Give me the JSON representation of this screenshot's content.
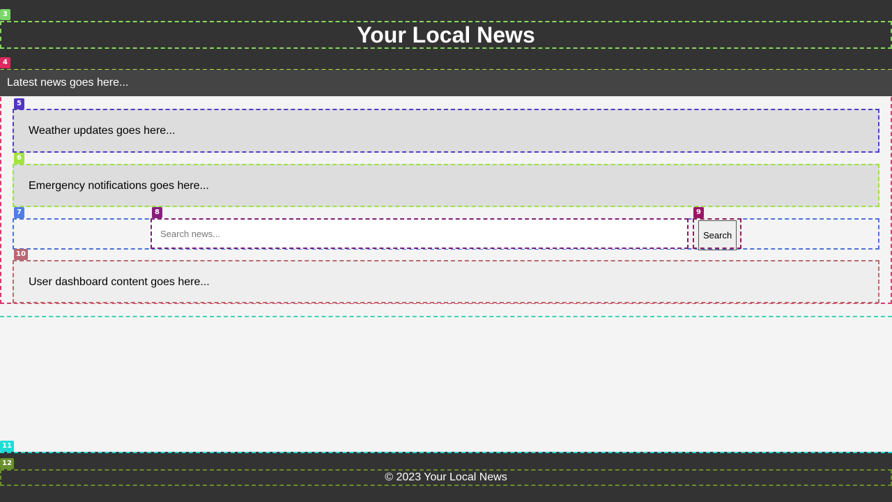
{
  "header": {
    "title": "Your Local News"
  },
  "ticker": {
    "text": "Latest news goes here..."
  },
  "weather": {
    "text": "Weather updates goes here..."
  },
  "emergency": {
    "text": "Emergency notifications goes here..."
  },
  "search": {
    "value": "",
    "placeholder": "Search news...",
    "button_label": "Search"
  },
  "dashboard": {
    "text": "User dashboard content goes here..."
  },
  "footer": {
    "text": "© 2023 Your Local News"
  },
  "tags": [
    {
      "label": "3",
      "color": "#7bd66a"
    },
    {
      "label": "4",
      "color": "#e0285f"
    },
    {
      "label": "5",
      "color": "#5335c4"
    },
    {
      "label": "6",
      "color": "#a3e33d"
    },
    {
      "label": "7",
      "color": "#4f7ee6"
    },
    {
      "label": "8",
      "color": "#871f7d"
    },
    {
      "label": "9",
      "color": "#9a1565"
    },
    {
      "label": "10",
      "color": "#b86872"
    },
    {
      "label": "11",
      "color": "#20dcd7"
    },
    {
      "label": "12",
      "color": "#6a8f2b"
    }
  ],
  "colors": {
    "header_bg": "#333333",
    "ticker_bg": "#444444",
    "page_bg": "#f4f4f4",
    "panel_bg": "#dddddd"
  }
}
